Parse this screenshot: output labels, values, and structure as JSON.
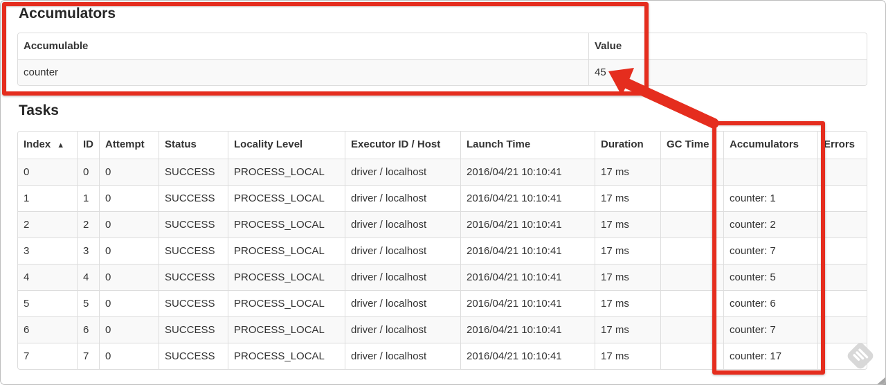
{
  "accumulators": {
    "title": "Accumulators",
    "columns": [
      "Accumulable",
      "Value"
    ],
    "rows": [
      [
        "counter",
        "45"
      ]
    ]
  },
  "tasks": {
    "title": "Tasks",
    "columns": [
      "Index",
      "ID",
      "Attempt",
      "Status",
      "Locality Level",
      "Executor ID / Host",
      "Launch Time",
      "Duration",
      "GC Time",
      "Accumulators",
      "Errors"
    ],
    "sorted_column": "Index",
    "sort_icon": "▲",
    "rows": [
      [
        "0",
        "0",
        "0",
        "SUCCESS",
        "PROCESS_LOCAL",
        "driver / localhost",
        "2016/04/21 10:10:41",
        "17 ms",
        "",
        "",
        ""
      ],
      [
        "1",
        "1",
        "0",
        "SUCCESS",
        "PROCESS_LOCAL",
        "driver / localhost",
        "2016/04/21 10:10:41",
        "17 ms",
        "",
        "counter: 1",
        ""
      ],
      [
        "2",
        "2",
        "0",
        "SUCCESS",
        "PROCESS_LOCAL",
        "driver / localhost",
        "2016/04/21 10:10:41",
        "17 ms",
        "",
        "counter: 2",
        ""
      ],
      [
        "3",
        "3",
        "0",
        "SUCCESS",
        "PROCESS_LOCAL",
        "driver / localhost",
        "2016/04/21 10:10:41",
        "17 ms",
        "",
        "counter: 7",
        ""
      ],
      [
        "4",
        "4",
        "0",
        "SUCCESS",
        "PROCESS_LOCAL",
        "driver / localhost",
        "2016/04/21 10:10:41",
        "17 ms",
        "",
        "counter: 5",
        ""
      ],
      [
        "5",
        "5",
        "0",
        "SUCCESS",
        "PROCESS_LOCAL",
        "driver / localhost",
        "2016/04/21 10:10:41",
        "17 ms",
        "",
        "counter: 6",
        ""
      ],
      [
        "6",
        "6",
        "0",
        "SUCCESS",
        "PROCESS_LOCAL",
        "driver / localhost",
        "2016/04/21 10:10:41",
        "17 ms",
        "",
        "counter: 7",
        ""
      ],
      [
        "7",
        "7",
        "0",
        "SUCCESS",
        "PROCESS_LOCAL",
        "driver / localhost",
        "2016/04/21 10:10:41",
        "17 ms",
        "",
        "counter: 17",
        ""
      ]
    ]
  },
  "annotations": {
    "color": "#e52d1e"
  }
}
